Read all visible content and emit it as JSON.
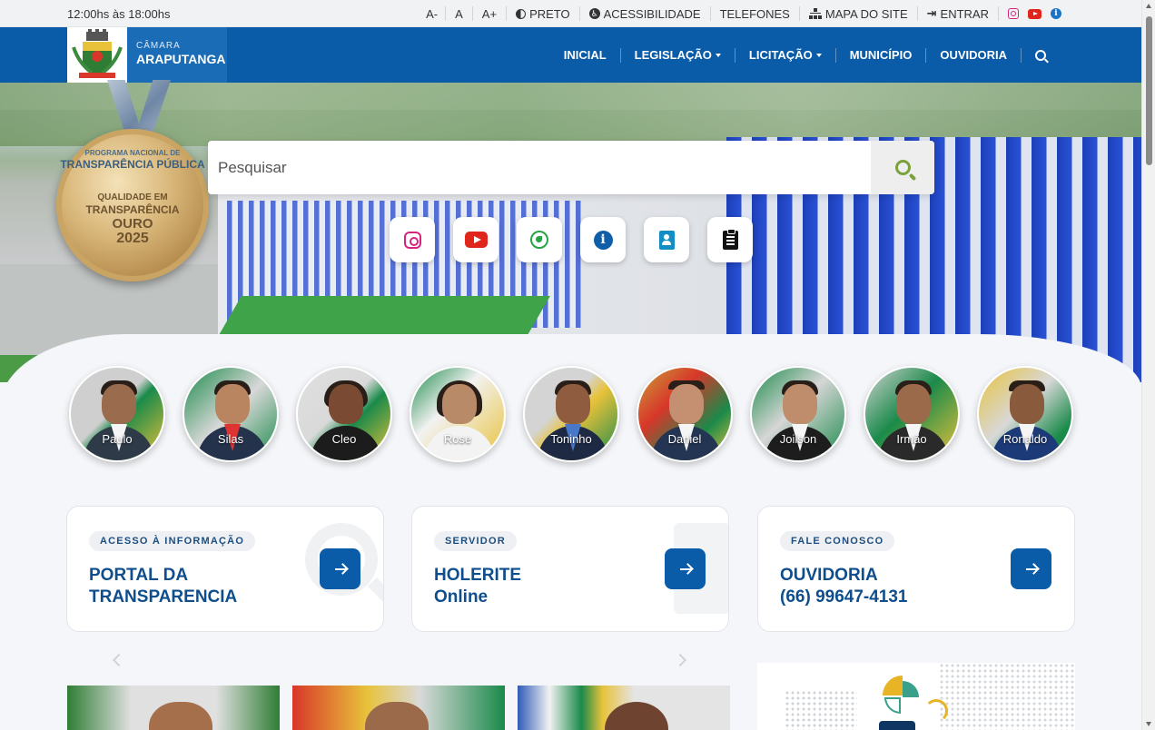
{
  "topbar": {
    "hours": "12:00hs às 18:00hs",
    "font_decrease": "A-",
    "font_normal": "A",
    "font_increase": "A+",
    "contrast": "PRETO",
    "accessibility": "ACESSIBILIDADE",
    "phones": "TELEFONES",
    "sitemap": "MAPA DO SITE",
    "login": "ENTRAR",
    "icons": [
      "instagram-icon",
      "youtube-icon",
      "info-icon"
    ]
  },
  "brand": {
    "small": "CÂMARA",
    "name": "ARAPUTANGA"
  },
  "nav": {
    "items": [
      "INICIAL",
      "LEGISLAÇÃO",
      "LICITAÇÃO",
      "MUNICÍPIO",
      "OUVIDORIA"
    ]
  },
  "medal": {
    "line1": "PROGRAMA NACIONAL DE",
    "line2": "TRANSPARÊNCIA PÚBLICA",
    "line3": "QUALIDADE EM",
    "line4": "TRANSPARÊNCIA",
    "line5": "OURO",
    "line6": "2025"
  },
  "search": {
    "placeholder": "Pesquisar"
  },
  "quick_links": [
    "instagram-icon",
    "youtube-icon",
    "whatsapp-icon",
    "info-icon",
    "contacts-icon",
    "clipboard-icon"
  ],
  "councillors": [
    "Paulo",
    "Silas",
    "Cleo",
    "Rose",
    "Toninho",
    "Daniel",
    "Joilson",
    "Irmão",
    "Ronaldo"
  ],
  "cards": [
    {
      "tag": "ACESSO À INFORMAÇÃO",
      "title_line1": "PORTAL DA",
      "title_line2": "TRANSPARENCIA"
    },
    {
      "tag": "SERVIDOR",
      "title_line1": "HOLERITE",
      "title_line2": "Online"
    },
    {
      "tag": "FALE CONOSCO",
      "title_line1": "OUVIDORIA",
      "title_line2": "(66) 99647-4131"
    }
  ],
  "colors": {
    "primary": "#0a5ba8",
    "topbar_bg": "#f1f2f3",
    "accent_green": "#7aa23c",
    "card_title": "#0f4e8c"
  }
}
